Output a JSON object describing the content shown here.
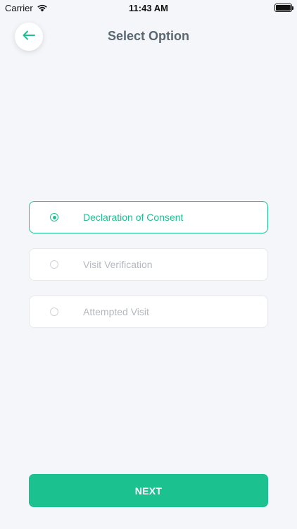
{
  "status_bar": {
    "carrier": "Carrier",
    "time": "11:43 AM",
    "wifi_icon": "wifi-icon",
    "battery_icon": "battery-icon"
  },
  "header": {
    "back_icon": "arrow-left-icon",
    "title": "Select Option"
  },
  "options": [
    {
      "label": "Declaration of Consent",
      "selected": true
    },
    {
      "label": "Visit Verification",
      "selected": false
    },
    {
      "label": "Attempted Visit",
      "selected": false
    }
  ],
  "footer": {
    "next_label": "NEXT"
  },
  "colors": {
    "accent": "#1cc190",
    "background": "#f5f6fa",
    "title_text": "#5a6770",
    "muted_text": "#b4b9bf"
  }
}
